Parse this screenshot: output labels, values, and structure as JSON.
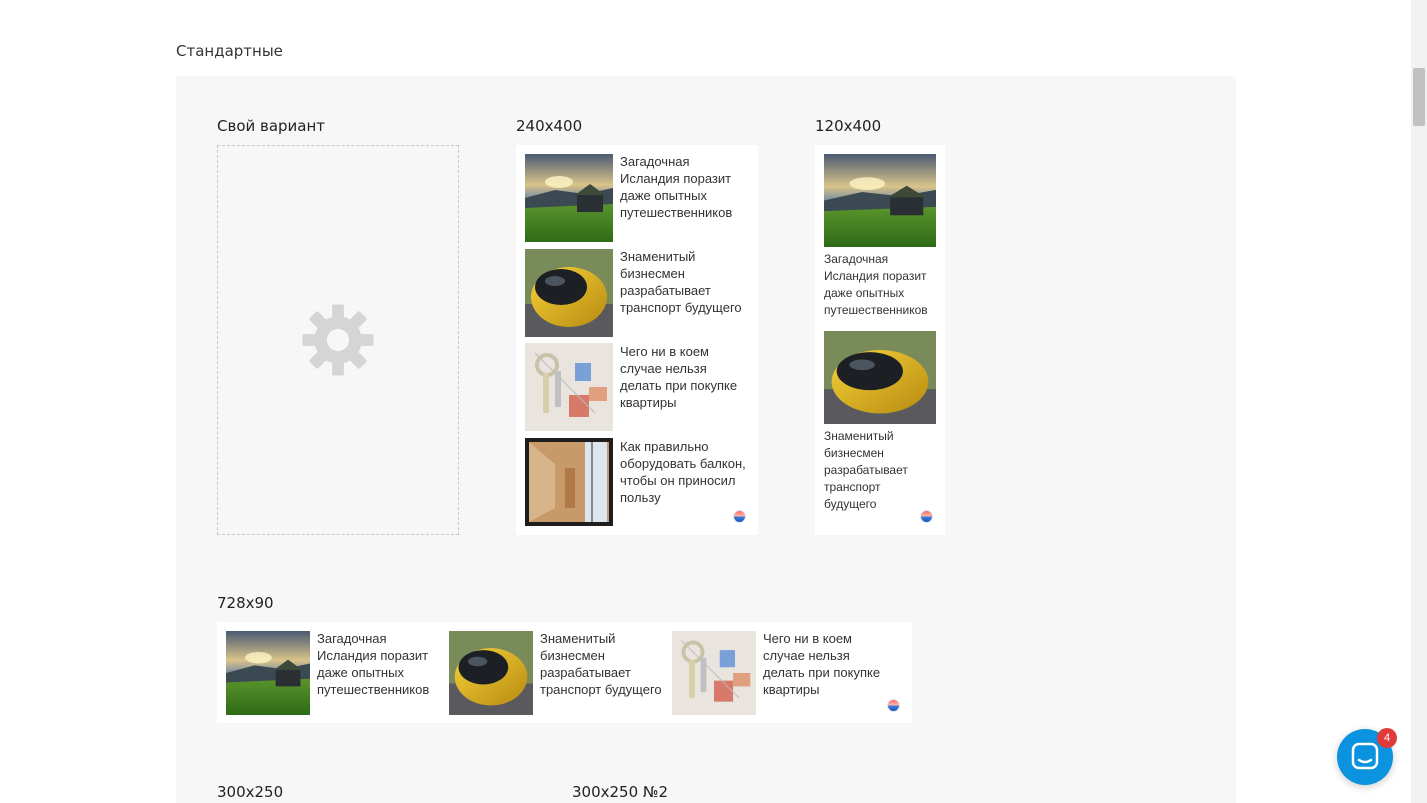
{
  "section_title": "Стандартные",
  "formats": {
    "custom": "Свой вариант",
    "f240": "240x400",
    "f120": "120x400",
    "f728": "728x90",
    "f300a": "300x250",
    "f300b": "300x250 №2"
  },
  "articles": [
    {
      "image": "iceland",
      "text": [
        "Загадочная",
        "Исландия поразит",
        "даже опытных",
        "путешественников"
      ]
    },
    {
      "image": "pod-car",
      "text": [
        "Знаменитый",
        "бизнесмен",
        "разрабатывает",
        "транспорт будущего"
      ]
    },
    {
      "image": "keys",
      "text": [
        "Чего ни в коем",
        "случае нельзя",
        "делать при покупке",
        "квартиры"
      ]
    },
    {
      "image": "balcony",
      "text": [
        "Как правильно",
        "оборудовать балкон,",
        "чтобы он приносил",
        "пользу"
      ]
    }
  ],
  "w120_articles": [
    {
      "image": "iceland",
      "text": [
        "Загадочная",
        "Исландия поразит",
        "даже опытных",
        "путешественников"
      ]
    },
    {
      "image": "pod-car",
      "text": [
        "Знаменитый",
        "бизнесмен",
        "разрабатывает",
        "транспорт",
        "будущего"
      ]
    }
  ],
  "chat": {
    "badge": "4"
  },
  "colors": {
    "panel": "#f7f7f7",
    "accent": "#0b93e0",
    "badge": "#e13a3a"
  }
}
